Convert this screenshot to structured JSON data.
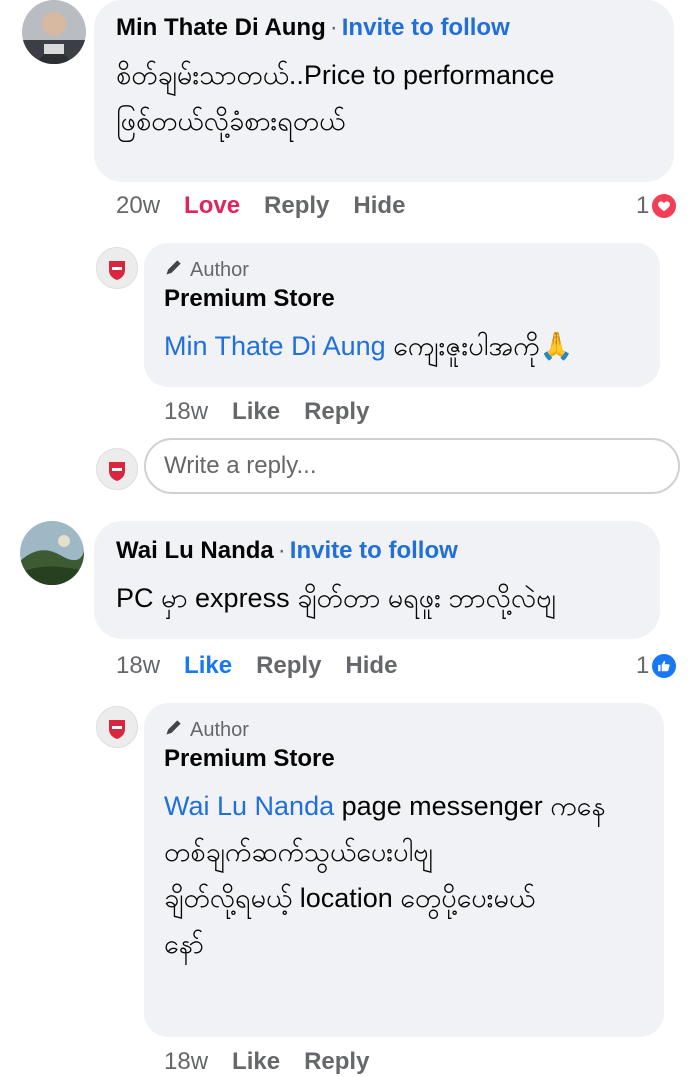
{
  "comments": [
    {
      "author": "Min Thate Di Aung",
      "follow_label": "Invite to follow",
      "text_line1": "စိတ်ချမ်းသာတယ်..Price to performance",
      "text_line2": "ဖြစ်တယ်လို့ခံစားရတယ်",
      "time": "20w",
      "reaction_action": "Love",
      "reply_label": "Reply",
      "hide_label": "Hide",
      "reaction_count": "1",
      "reaction_icon": "heart-icon",
      "reply": {
        "badge": "Author",
        "author": "Premium Store",
        "mention": "Min Thate Di Aung",
        "text_line1": " ကျေးဇူးပါအကို🙏",
        "time": "18w",
        "like_label": "Like",
        "reply_label": "Reply"
      },
      "reply_box_placeholder": "Write a reply..."
    },
    {
      "author": "Wai Lu Nanda",
      "follow_label": "Invite to follow",
      "text_line1": "PC မှာ express ချိတ်တာ မရဖူး ဘာလို့လဲဗျ",
      "time": "18w",
      "reaction_action": "Like",
      "reply_label": "Reply",
      "hide_label": "Hide",
      "reaction_count": "1",
      "reaction_icon": "like-icon",
      "reply": {
        "badge": "Author",
        "author": "Premium Store",
        "mention": "Wai Lu Nanda",
        "text_line1": " page messenger ကနေ",
        "text_line2": "တစ်ချက်ဆက်သွယ်ပေးပါဗျ",
        "text_line3": "ချိတ်လို့ရမယ့် location တွေပို့ပေးမယ်",
        "text_line4": "နော်",
        "time": "18w",
        "like_label": "Like",
        "reply_label": "Reply"
      }
    }
  ],
  "colors": {
    "bubble": "#f0f2f5",
    "link": "#216fdb",
    "love": "#e0245e",
    "like": "#1877f2",
    "muted": "#65676b"
  }
}
